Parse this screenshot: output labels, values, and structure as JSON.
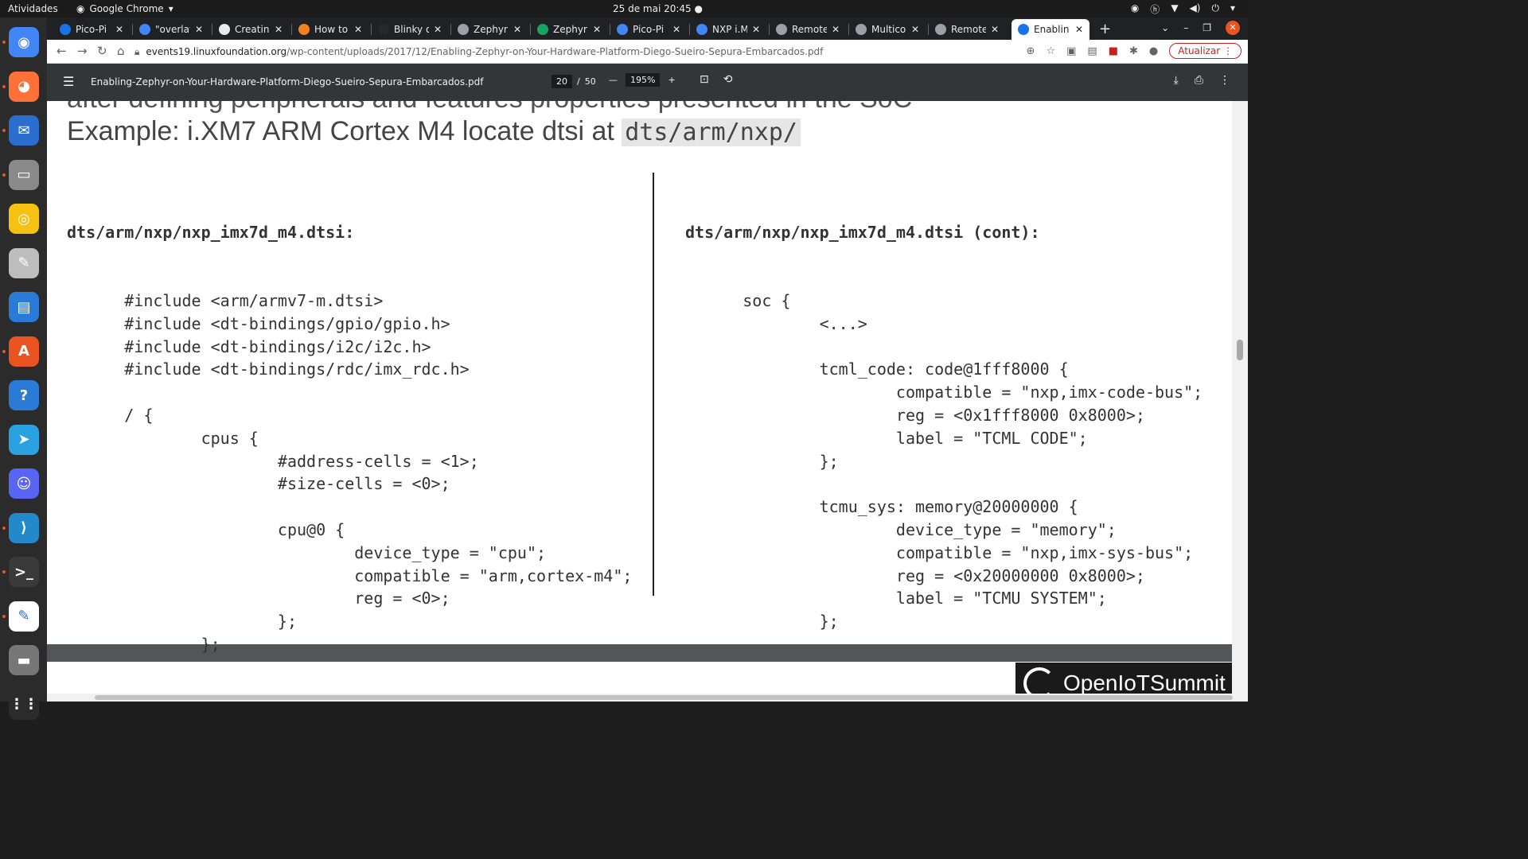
{
  "system": {
    "activities": "Atividades",
    "app_name": "Google Chrome",
    "datetime": "25 de mai  20:45"
  },
  "tabs": [
    {
      "label": "Pico-Pi I",
      "color": "#1a73e8"
    },
    {
      "label": "\"overlay",
      "color": "#4285f4"
    },
    {
      "label": "Creating",
      "color": "#e8eaed"
    },
    {
      "label": "How to s",
      "color": "#f48024"
    },
    {
      "label": "Blinky o",
      "color": "#24292e"
    },
    {
      "label": "Zephyr B",
      "color": "#9aa0a6"
    },
    {
      "label": "Zephyr A",
      "color": "#1aa260"
    },
    {
      "label": "Pico-Pi i.",
      "color": "#4285f4"
    },
    {
      "label": "NXP i.M",
      "color": "#4285f4"
    },
    {
      "label": "Remote",
      "color": "#9aa0a6"
    },
    {
      "label": "Multicor",
      "color": "#9aa0a6"
    },
    {
      "label": "Remote",
      "color": "#9aa0a6"
    },
    {
      "label": "Enablin",
      "color": "#1a73e8"
    }
  ],
  "address": {
    "host": "events19.linuxfoundation.org",
    "path": "/wp-content/uploads/2017/12/Enabling-Zephyr-on-Your-Hardware-Platform-Diego-Sueiro-Sepura-Embarcados.pdf"
  },
  "update_button": "Atualizar",
  "pdf": {
    "filename": "Enabling-Zephyr-on-Your-Hardware-Platform-Diego-Sueiro-Sepura-Embarcados.pdf",
    "current_page": "20",
    "page_sep": "/",
    "total_pages": "50",
    "zoom": "195%"
  },
  "slide": {
    "cut_line": "after defining peripherals and features properties presented in the SoC",
    "heading_text": "Example: i.XM7 ARM Cortex M4 locate dtsi at ",
    "heading_code": "dts/arm/nxp/",
    "left_header": "dts/arm/nxp/nxp_imx7d_m4.dtsi:",
    "left_lines": [
      "      #include <arm/armv7-m.dtsi>",
      "      #include <dt-bindings/gpio/gpio.h>",
      "      #include <dt-bindings/i2c/i2c.h>",
      "      #include <dt-bindings/rdc/imx_rdc.h>",
      "",
      "      / {",
      "              cpus {",
      "                      #address-cells = <1>;",
      "                      #size-cells = <0>;",
      "",
      "                      cpu@0 {",
      "                              device_type = \"cpu\";",
      "                              compatible = \"arm,cortex-m4\";",
      "                              reg = <0>;",
      "                      };",
      "              };"
    ],
    "right_header": "dts/arm/nxp/nxp_imx7d_m4.dtsi (cont):",
    "right_lines": [
      "      soc {",
      "              <...>",
      "",
      "              tcml_code: code@1fff8000 {",
      "                      compatible = \"nxp,imx-code-bus\";",
      "                      reg = <0x1fff8000 0x8000>;",
      "                      label = \"TCML CODE\";",
      "              };",
      "",
      "              tcmu_sys: memory@20000000 {",
      "                      device_type = \"memory\";",
      "                      compatible = \"nxp,imx-sys-bus\";",
      "                      reg = <0x20000000 0x8000>;",
      "                      label = \"TCMU SYSTEM\";",
      "              };",
      "",
      "              <...>"
    ],
    "logo_text": "OpenIoTSummit"
  },
  "dock": [
    {
      "name": "chrome-icon",
      "color": "#4285f4",
      "glyph": "◉"
    },
    {
      "name": "firefox-icon",
      "color": "#ff7139",
      "glyph": "◕"
    },
    {
      "name": "thunderbird-icon",
      "color": "#2a6ecf",
      "glyph": "✉"
    },
    {
      "name": "files-icon",
      "color": "#8a8a8a",
      "glyph": "▭"
    },
    {
      "name": "rhythmbox-icon",
      "color": "#f5c211",
      "glyph": "◎"
    },
    {
      "name": "text-editor-icon",
      "color": "#bdbdbd",
      "glyph": "✎"
    },
    {
      "name": "writer-icon",
      "color": "#2a7bd8",
      "glyph": "▤"
    },
    {
      "name": "software-icon",
      "color": "#e95420",
      "glyph": "A"
    },
    {
      "name": "help-icon",
      "color": "#2a7bd8",
      "glyph": "?"
    },
    {
      "name": "telegram-icon",
      "color": "#2aa1e0",
      "glyph": "➤"
    },
    {
      "name": "discord-icon",
      "color": "#5865f2",
      "glyph": "☺"
    },
    {
      "name": "vscode-icon",
      "color": "#2489ca",
      "glyph": "⟩"
    },
    {
      "name": "terminal-icon",
      "color": "#3a3a3a",
      "glyph": ">_"
    },
    {
      "name": "notes-icon",
      "color": "#ffffff",
      "glyph": "✎"
    },
    {
      "name": "drive-icon",
      "color": "#777777",
      "glyph": "▬"
    },
    {
      "name": "app-grid-icon",
      "color": "#2b2b2b",
      "glyph": "⋮⋮"
    }
  ]
}
